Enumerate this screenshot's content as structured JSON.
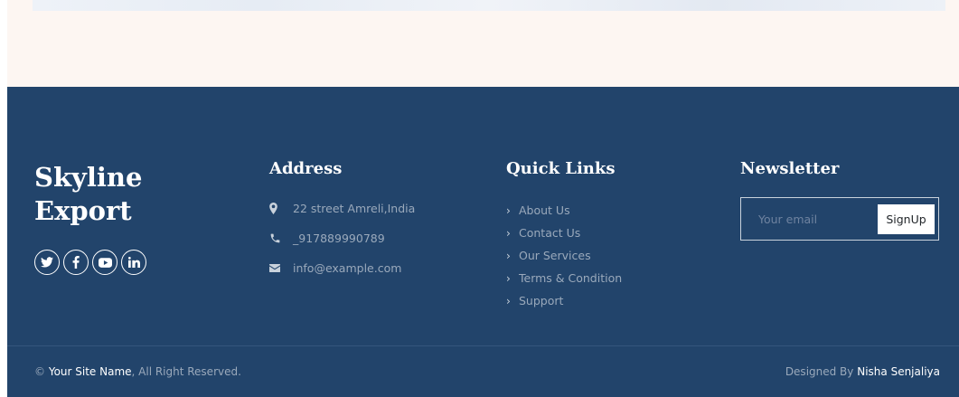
{
  "brand": {
    "line1": "Skyline",
    "line2": "Export"
  },
  "socials": [
    {
      "icon": "twitter-icon"
    },
    {
      "icon": "facebook-icon"
    },
    {
      "icon": "youtube-icon"
    },
    {
      "icon": "linkedin-icon"
    }
  ],
  "address": {
    "title": "Address",
    "items": [
      {
        "icon": "map-marker-icon",
        "text": "22 street Amreli,India"
      },
      {
        "icon": "phone-icon",
        "text": "_917889990789"
      },
      {
        "icon": "envelope-icon",
        "text": "info@example.com"
      }
    ]
  },
  "quick_links": {
    "title": "Quick Links",
    "items": [
      "About Us",
      "Contact Us",
      "Our Services",
      "Terms & Condition",
      "Support"
    ]
  },
  "newsletter": {
    "title": "Newsletter",
    "placeholder": "Your email",
    "button": "SignUp"
  },
  "footer_bottom": {
    "copyright_symbol": "©",
    "site_name": "Your Site Name",
    "rights": ", All Right Reserved.",
    "designed_prefix": "Designed By",
    "designer": "Nisha Senjaliya"
  },
  "colors": {
    "footer_bg": "#22446b",
    "muted_text": "#9aa9bb",
    "top_band": "#fdf6f2"
  }
}
